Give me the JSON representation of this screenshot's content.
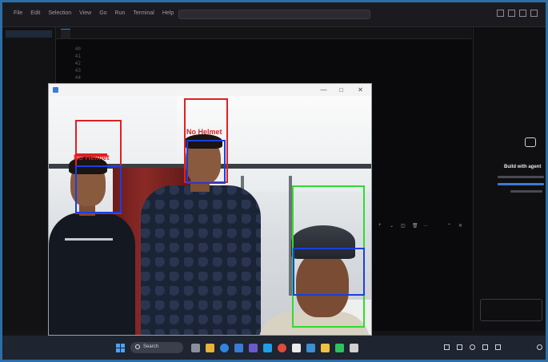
{
  "ide": {
    "menu": [
      "File",
      "Edit",
      "Selection",
      "View",
      "Go",
      "Run",
      "Terminal",
      "Help"
    ],
    "search_text": "",
    "sidebar_items": [
      "",
      "",
      "",
      "",
      "",
      "",
      ""
    ],
    "tabs": [
      {
        "label": ""
      },
      {
        "label": ""
      }
    ],
    "breadcrumb": "",
    "line_numbers": [
      "40",
      "41",
      "42",
      "43",
      "44"
    ],
    "code_lines": [
      "",
      "",
      "",
      "",
      ""
    ],
    "chat_title": "Build with agent"
  },
  "camera_window": {
    "title": "",
    "controls": {
      "minimize": "—",
      "maximize": "□",
      "close": "✕"
    },
    "detections": [
      {
        "label": "No Helmet",
        "color": "#e02020"
      },
      {
        "label": "No Helmet",
        "color": "#e02020"
      },
      {
        "label": "",
        "color": "#2fdc2f"
      }
    ],
    "face_box_color": "#1b3fe0"
  },
  "taskbar": {
    "search_label": "Search",
    "icons": [
      "start-icon",
      "search-icon",
      "task-view-icon",
      "file-explorer-icon",
      "edge-icon",
      "store-icon",
      "teams-icon",
      "vscode-icon",
      "chrome-icon",
      "settings-icon",
      "python-icon",
      "camera-icon"
    ],
    "time": "",
    "date": ""
  },
  "colors": {
    "frame_border": "#2c6ea6",
    "ide_background": "#0a0a0c",
    "taskbar": "#1e2430",
    "accent": "#3a7bd5"
  }
}
